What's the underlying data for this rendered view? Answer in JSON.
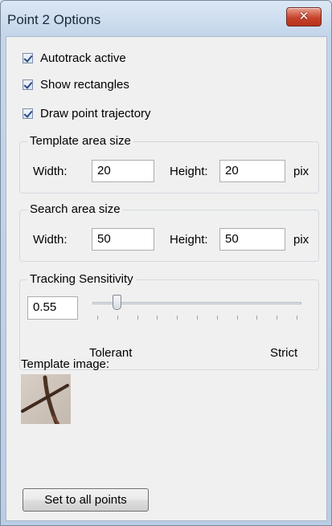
{
  "window": {
    "title": "Point 2 Options",
    "close_glyph": "✕"
  },
  "checkboxes": [
    {
      "label": "Autotrack active",
      "checked": true
    },
    {
      "label": "Show rectangles",
      "checked": true
    },
    {
      "label": "Draw point trajectory",
      "checked": true
    }
  ],
  "template_area": {
    "legend": "Template area size",
    "width_label": "Width:",
    "width_value": "20",
    "height_label": "Height:",
    "height_value": "20",
    "unit": "pix"
  },
  "search_area": {
    "legend": "Search area size",
    "width_label": "Width:",
    "width_value": "50",
    "height_label": "Height:",
    "height_value": "50",
    "unit": "pix"
  },
  "tracking": {
    "legend": "Tracking Sensitivity",
    "value": "0.55",
    "slider_position": 0.1,
    "min_label": "Tolerant",
    "max_label": "Strict"
  },
  "template_image": {
    "label": "Template image:"
  },
  "set_all_button": "Set to all points"
}
